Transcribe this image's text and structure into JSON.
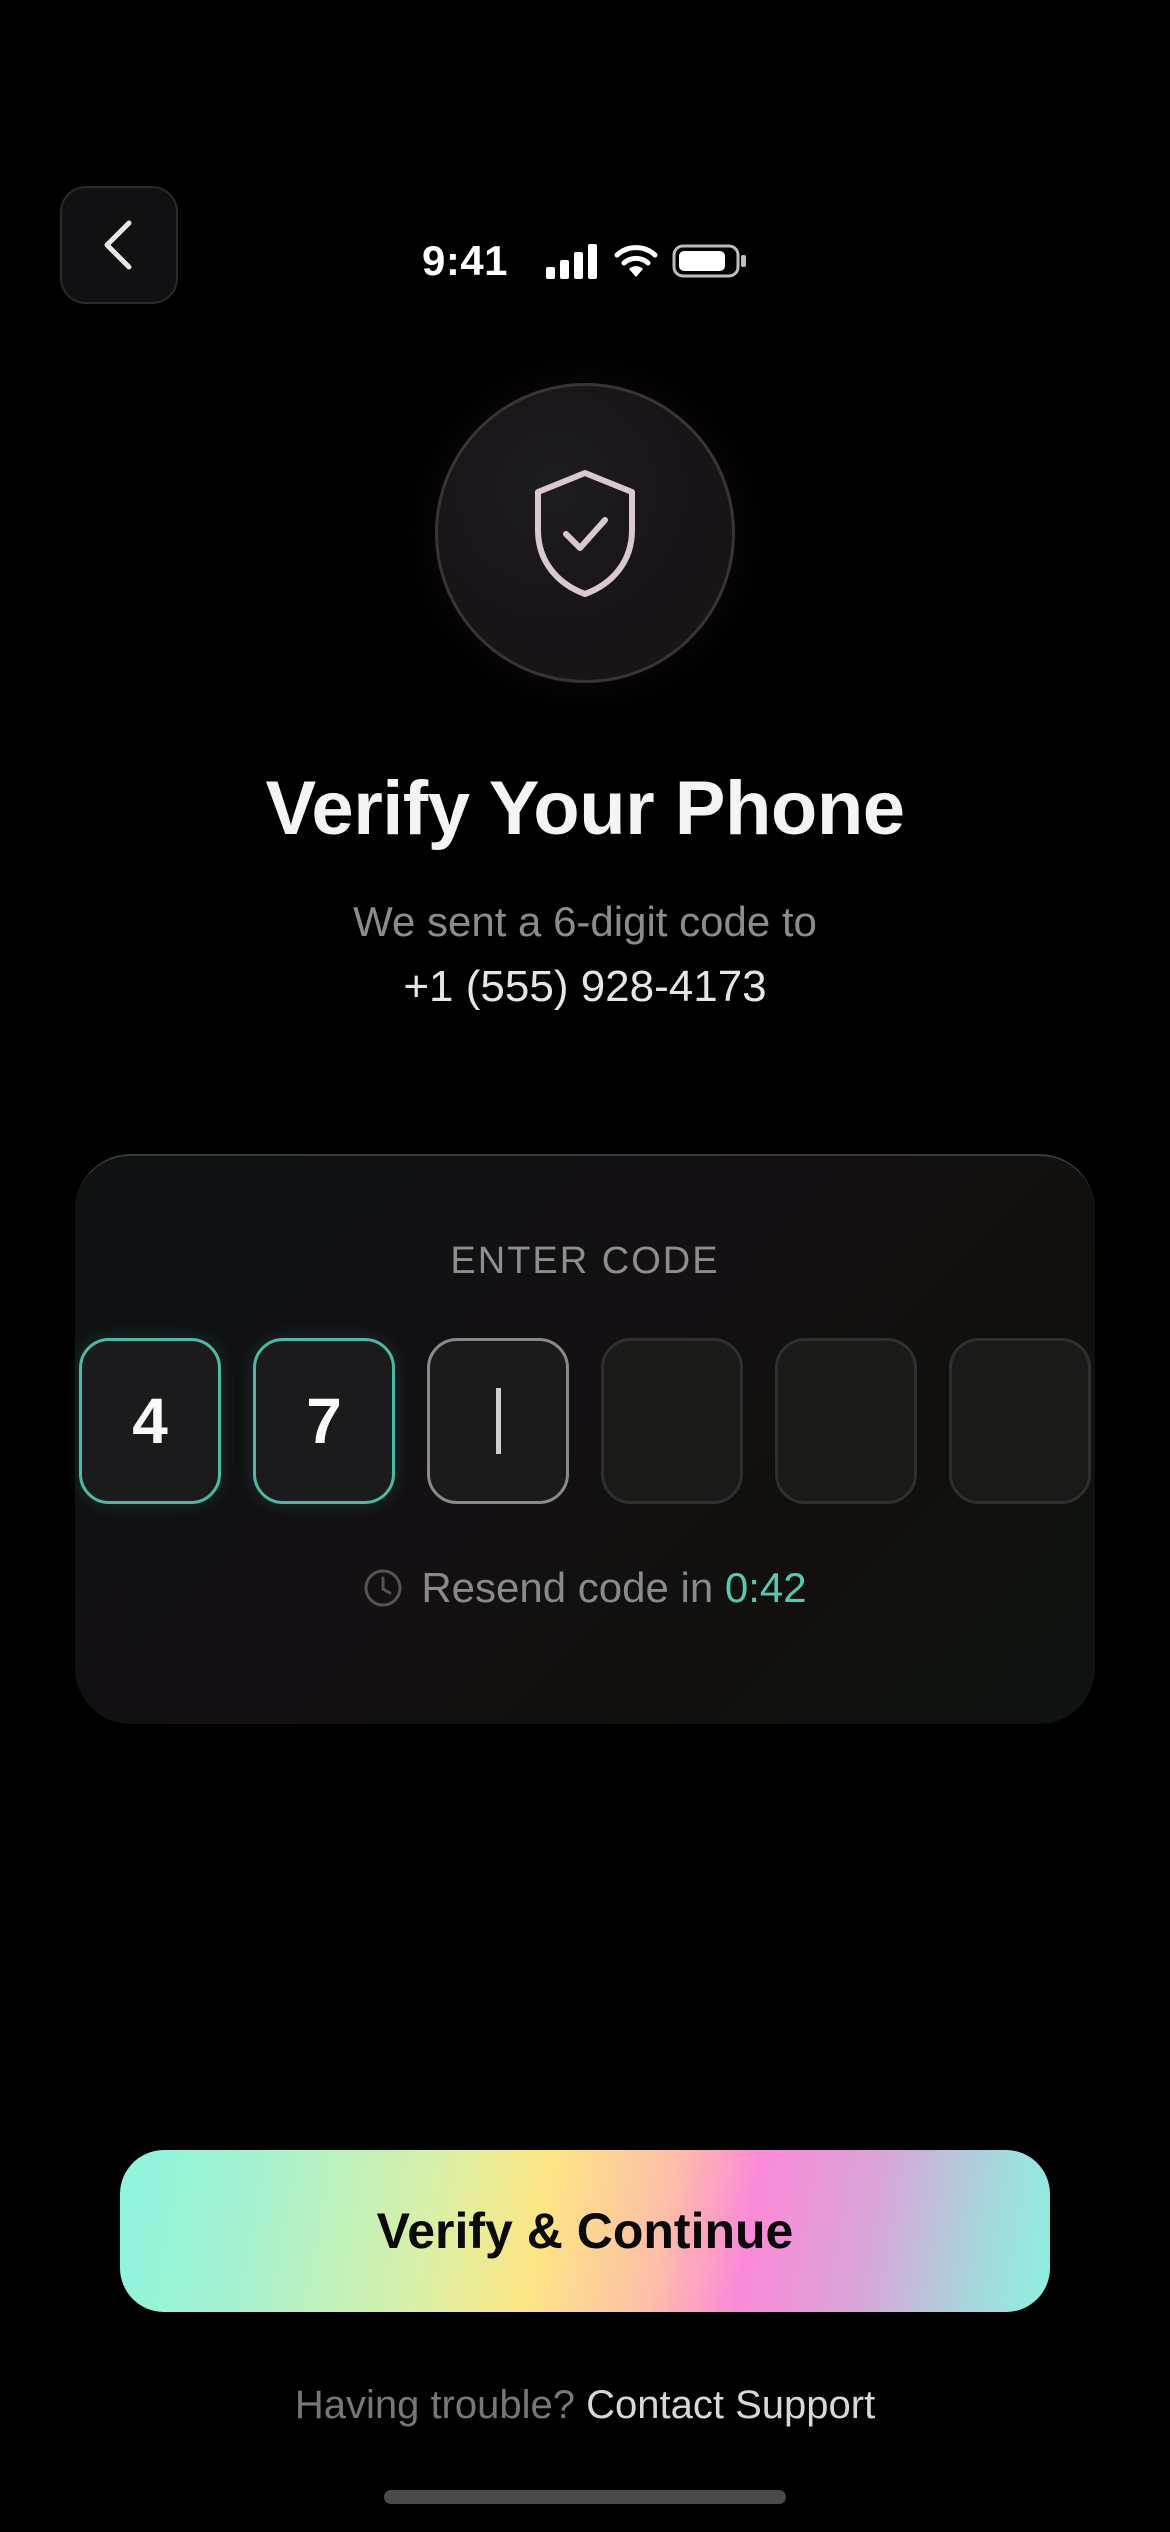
{
  "status_bar": {
    "time": "9:41"
  },
  "header": {
    "back_icon": "chevron-left-icon"
  },
  "hero": {
    "icon": "shield-check-icon",
    "title": "Verify Your Phone",
    "subtitle": "We sent a 6-digit code to",
    "phone_number": "+1 (555) 928-4173"
  },
  "code_card": {
    "label": "ENTER CODE",
    "digits": [
      "4",
      "7",
      "",
      "",
      "",
      ""
    ],
    "active_index": 2,
    "resend_label": "Resend code in",
    "resend_timer": "0:42",
    "resend_icon": "clock-icon"
  },
  "actions": {
    "verify_label": "Verify & Continue"
  },
  "footer": {
    "trouble_text": "Having trouble?",
    "support_link": "Contact Support"
  },
  "colors": {
    "accent_teal": "#55c9b2",
    "filled_border": "#4fb8a5",
    "background": "#000000"
  }
}
